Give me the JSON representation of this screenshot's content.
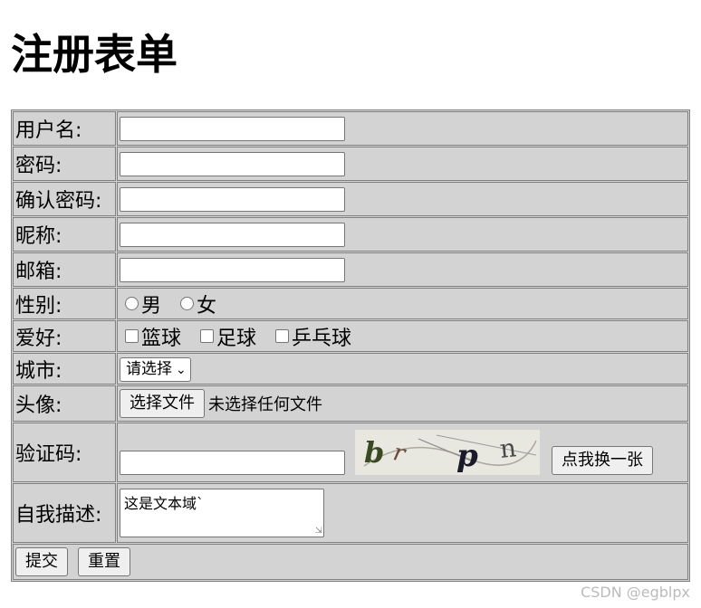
{
  "page": {
    "title": "注册表单",
    "watermark": "CSDN @egblpx"
  },
  "form": {
    "username_label": "用户名:",
    "password_label": "密码:",
    "confirm_label": "确认密码:",
    "nickname_label": "昵称:",
    "email_label": "邮箱:",
    "gender_label": "性别:",
    "gender_options": [
      "男",
      "女"
    ],
    "hobby_label": "爱好:",
    "hobby_options": [
      "篮球",
      "足球",
      "乒乓球"
    ],
    "city_label": "城市:",
    "city_selected": "请选择",
    "avatar_label": "头像:",
    "file_button": "选择文件",
    "file_status": "未选择任何文件",
    "captcha_label": "验证码:",
    "captcha_text": "brpn",
    "captcha_refresh": "点我换一张",
    "desc_label": "自我描述:",
    "desc_value": "这是文本域`",
    "submit": "提交",
    "reset": "重置"
  }
}
